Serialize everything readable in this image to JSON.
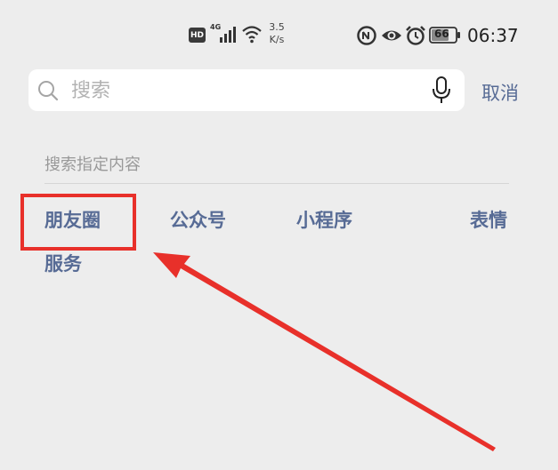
{
  "status_bar": {
    "hd_label": "HD",
    "network_label": "4G",
    "speed_value": "3.5",
    "speed_unit": "K/s",
    "battery_level": "66",
    "time": "06:37"
  },
  "search": {
    "placeholder": "搜索",
    "value": "",
    "cancel_label": "取消"
  },
  "filter": {
    "section_label": "搜索指定内容",
    "options": [
      {
        "label": "朋友圈"
      },
      {
        "label": "公众号"
      },
      {
        "label": "小程序"
      },
      {
        "label": "表情"
      },
      {
        "label": "服务"
      }
    ]
  },
  "annotation": {
    "color": "#e8302a",
    "highlighted_option": "朋友圈"
  },
  "colors": {
    "background": "#ededed",
    "link": "#576b95",
    "muted_text": "#999999"
  }
}
